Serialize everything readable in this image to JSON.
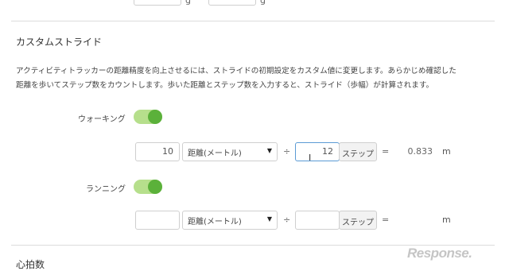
{
  "top_row": {
    "suffix_1": "g",
    "suffix_2": "g"
  },
  "custom_stride": {
    "heading": "カスタムストライド",
    "description_line1": "アクティビティトラッカーの距離精度を向上させるには、ストライドの初期設定をカスタム値に変更します。あらかじめ確認した",
    "description_line2": "距離を歩いてステップ数をカウントします。歩いた距離とステップ数を入力すると、ストライド（歩幅）が計算されます。"
  },
  "walking": {
    "label": "ウォーキング",
    "toggle_on": true,
    "distance_value": "10",
    "distance_unit_select": "距離(メートル)",
    "divide_symbol": "÷",
    "steps_value": "12",
    "steps_button": "ステップ",
    "equals_symbol": "=",
    "result_value": "0.833",
    "result_unit": "m"
  },
  "running": {
    "label": "ランニング",
    "toggle_on": true,
    "distance_value": "",
    "distance_unit_select": "距離(メートル)",
    "divide_symbol": "÷",
    "steps_value": "",
    "steps_button": "ステップ",
    "equals_symbol": "=",
    "result_value": "",
    "result_unit": "m"
  },
  "next_section": {
    "heading": "心拍数"
  },
  "watermark": {
    "text": "Response."
  },
  "colors": {
    "toggle_track": "#b6df8c",
    "toggle_knob": "#5bb13a",
    "focus_border": "#5b9bd5"
  }
}
